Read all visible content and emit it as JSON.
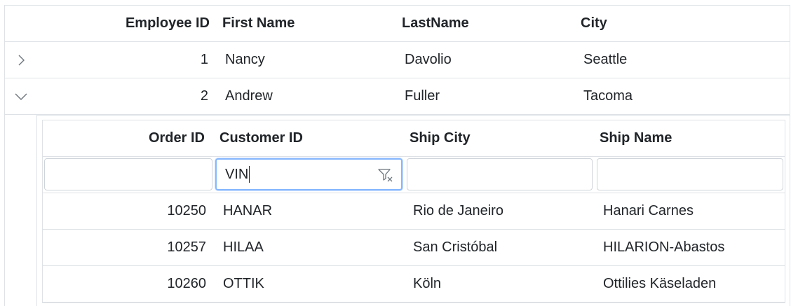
{
  "parent_grid": {
    "columns": [
      "Employee ID",
      "First Name",
      "LastName",
      "City"
    ],
    "rows": [
      {
        "employee_id": "1",
        "first_name": "Nancy",
        "last_name": "Davolio",
        "city": "Seattle",
        "expanded": false
      },
      {
        "employee_id": "2",
        "first_name": "Andrew",
        "last_name": "Fuller",
        "city": "Tacoma",
        "expanded": true
      }
    ]
  },
  "child_grid": {
    "columns": [
      "Order ID",
      "Customer ID",
      "Ship City",
      "Ship Name"
    ],
    "filters": {
      "order_id": "",
      "customer_id": "VIN",
      "ship_city": "",
      "ship_name": ""
    },
    "rows": [
      {
        "order_id": "10250",
        "customer_id": "HANAR",
        "ship_city": "Rio de Janeiro",
        "ship_name": "Hanari Carnes"
      },
      {
        "order_id": "10257",
        "customer_id": "HILAA",
        "ship_city": "San Cristóbal",
        "ship_name": "HILARION-Abastos"
      },
      {
        "order_id": "10260",
        "customer_id": "OTTIK",
        "ship_city": "Köln",
        "ship_name": "Ottilies Käseladen"
      }
    ]
  },
  "icons": {
    "collapsed": "chevron-right-icon",
    "expanded": "chevron-down-icon",
    "clear_filter": "filter-clear-icon"
  },
  "colors": {
    "border": "#dee2e6",
    "focus": "#86b7fe",
    "text": "#212529"
  }
}
